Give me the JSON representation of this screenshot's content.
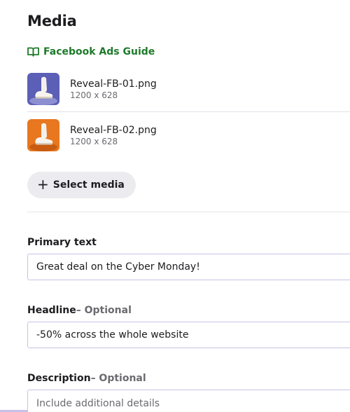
{
  "section": {
    "title": "Media",
    "guide_link": "Facebook Ads Guide"
  },
  "media": [
    {
      "name": "Reveal-FB-01.png",
      "dimensions": "1200 x 628",
      "thumb_bg": "#5b5fb5"
    },
    {
      "name": "Reveal-FB-02.png",
      "dimensions": "1200 x 628",
      "thumb_bg": "#e8771f"
    }
  ],
  "select_media_button": {
    "icon": "+",
    "label": "Select media"
  },
  "fields": {
    "primary_text": {
      "label": "Primary text",
      "value": "Great deal on the Cyber Monday!"
    },
    "headline": {
      "label": "Headline",
      "optional": "– Optional",
      "value": "-50% across the whole website"
    },
    "description": {
      "label": "Description",
      "optional": "– Optional",
      "value": "",
      "placeholder": "Include additional details"
    }
  },
  "colors": {
    "link": "#1e7a2b",
    "input_border": "#c6c3e6",
    "button_bg": "#ecebef"
  }
}
